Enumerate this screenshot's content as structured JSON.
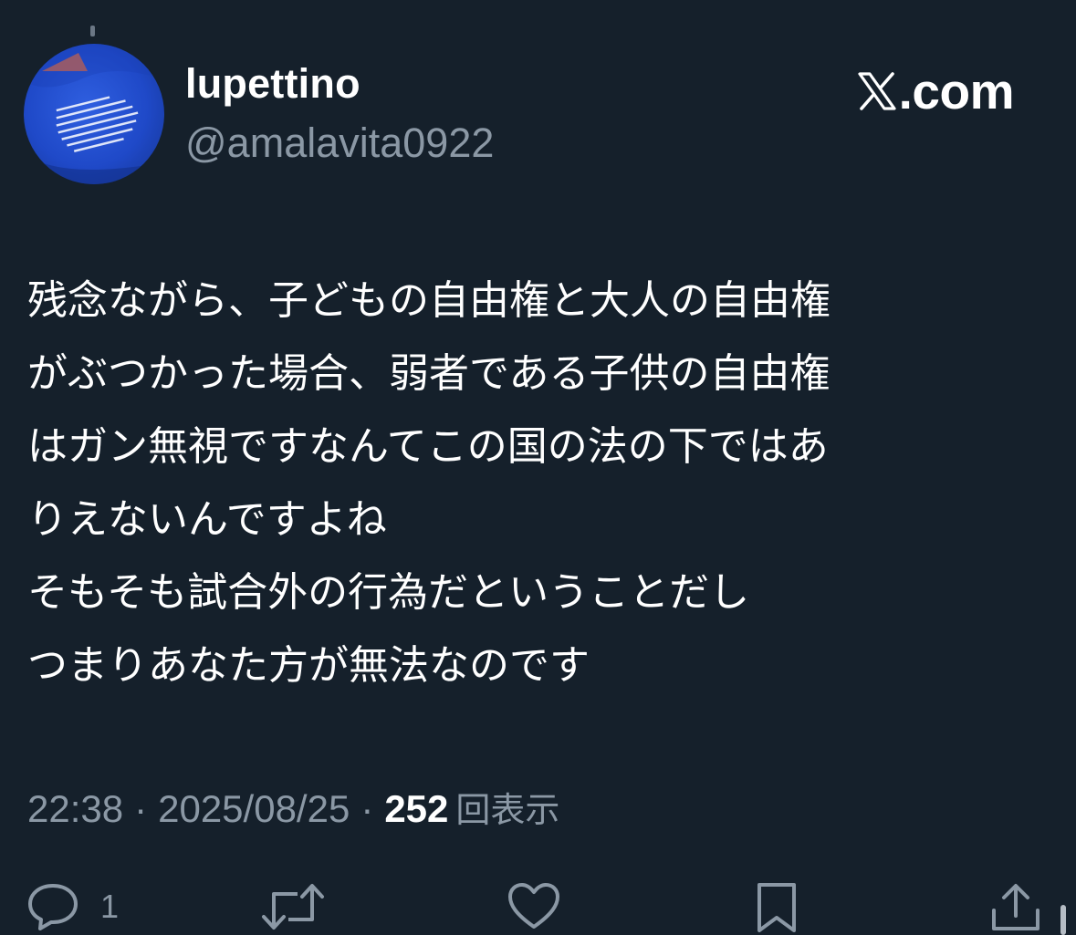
{
  "author": {
    "display_name": "lupettino",
    "handle": "@amalavita0922"
  },
  "brand": {
    "label": "𝕏.com",
    "text": ".com"
  },
  "tweet": {
    "lines": [
      "残念ながら、子どもの自由権と大人の自由権",
      "がぶつかった場合、弱者である子供の自由権",
      "はガン無視ですなんてこの国の法の下ではあ",
      "りえないんですよね",
      "そもそも試合外の行為だということだし",
      "つまりあなた方が無法なのです"
    ]
  },
  "meta": {
    "time": "22:38",
    "separator": "·",
    "date": "2025/08/25",
    "views_count": "252",
    "views_label": "回表示"
  },
  "actions": {
    "reply_count": "1",
    "icons": [
      "reply-icon",
      "retweet-icon",
      "like-icon",
      "bookmark-icon",
      "share-icon"
    ]
  },
  "colors": {
    "background": "#15202b",
    "primary_text": "#ffffff",
    "secondary_text": "#8b98a5",
    "avatar_blue": "#1f49c8"
  }
}
